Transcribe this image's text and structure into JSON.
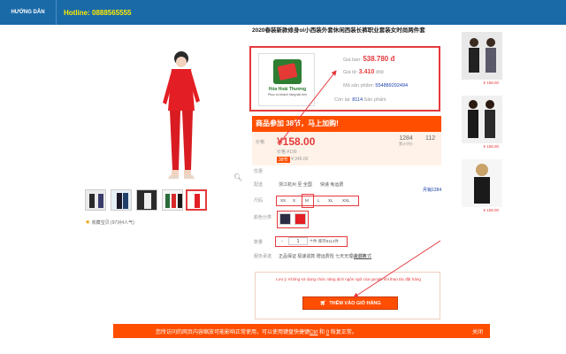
{
  "topbar": {
    "guide": "HƯỚNG DẪN",
    "hotline": "Hotline: 0888565555"
  },
  "product": {
    "title": "2020春装新款修身ol小西装外套休闲西装长裤职业套装女时尚两件套",
    "logo_name": "Hóa Hoài Thương",
    "logo_sub": "Phục vụ khách hàng tận tình",
    "sale_label": "Giá bán:",
    "sale_value": "538.780 đ",
    "cny_label": "Giá tệ:",
    "cny_value": "3.410",
    "cny_unit": "đ/tệ",
    "code_label": "Mã sản phẩm:",
    "code_value": "554889292494",
    "stock_label": "Còn lại:",
    "stock_value": "8114",
    "stock_unit": "Sản phẩm",
    "rating_text": "收藏宝贝 (97对4人气)"
  },
  "promo": {
    "text": "商品参加 38节，马上加购!"
  },
  "price_panel": {
    "label": "价格",
    "price": "¥158.00",
    "old": "价格 ¥199",
    "badge": "38节",
    "badge_note": "¥ 346.00",
    "sold": "1284",
    "sold_label": "累计评价",
    "reviews": "112"
  },
  "options": {
    "promo_label": "优惠",
    "ship_label": "配送",
    "ship_value": "浙江杭州 至 全国",
    "ship_right": "快递 免运费",
    "ship_link": "月销1284",
    "size_label": "尺码",
    "sizes": [
      "XS",
      "S",
      "M",
      "L",
      "XL",
      "XXL"
    ],
    "color_label": "颜色分类",
    "qty_label": "数量",
    "qty_minus": "-",
    "qty_value": "1",
    "qty_plus": "+",
    "qty_stock": "件 库存8114件",
    "service_label": "服务承诺",
    "service_value": "正品保证 极速退款 赠运费险 七天无理由退换",
    "service_link": "支付方式"
  },
  "cart": {
    "message": "Lưu ý: Không sử dụng chức năng dịch ngôn ngữ của google khi thao tác đặt hàng",
    "button": "THÊM VÀO GIỎ HÀNG"
  },
  "side": {
    "prices": [
      "¥ 158.00",
      "¥ 158.00",
      "¥ 158.00"
    ]
  },
  "notice": {
    "text_before": "您所访问的网页内容缩放可能影响正常使用，可以使用键盘快捷键",
    "key1": "Ctrl",
    "text_mid": "和",
    "key2": "0",
    "text_after": "恢复正常。",
    "close": "关闭"
  },
  "colors": {
    "accent": "#e4393c",
    "orange": "#ff4e00",
    "topbar": "#1a6aa8",
    "hotline": "#ffea00"
  }
}
